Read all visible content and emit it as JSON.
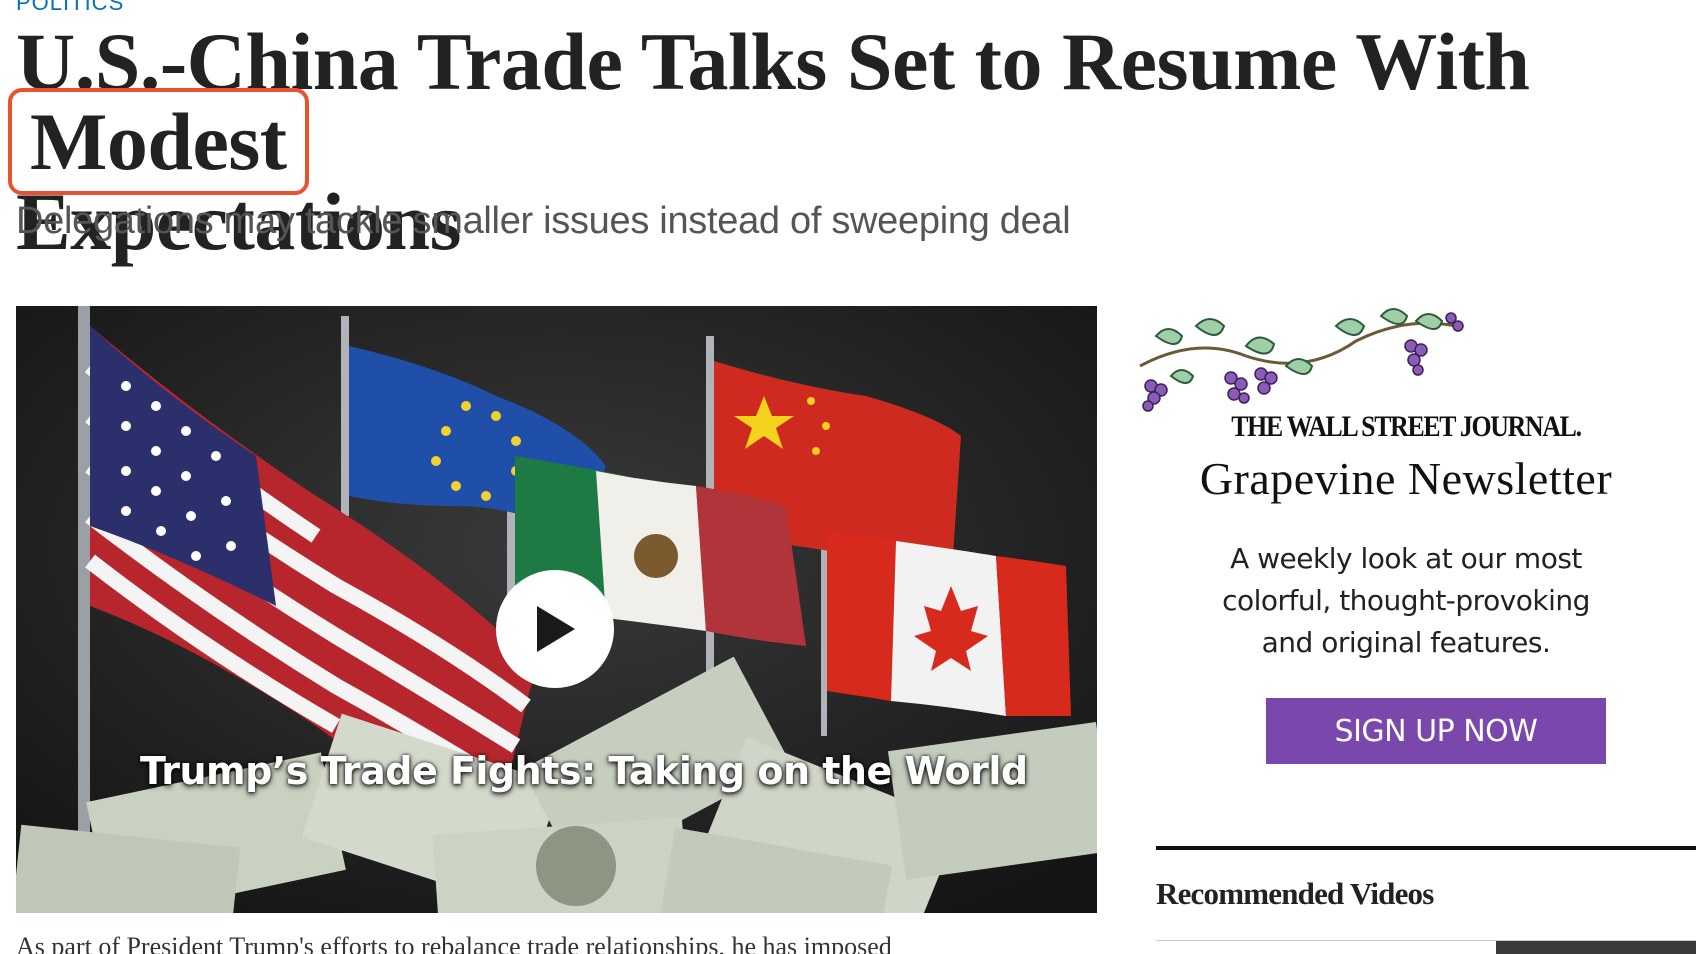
{
  "article": {
    "section": "POLITICS",
    "headline_main": "U.S.-China Trade Talks Set to Resume With",
    "headline_highlight": "Modest",
    "headline_tail": "Expectations",
    "dek": "Delegations may tackle smaller issues instead of sweeping deal",
    "body_first_line": "As part of President Trump's efforts to rebalance trade relationships, he has imposed",
    "highlight_color": "#e8522f"
  },
  "video": {
    "title": "Trump’s Trade Fights: Taking on the World",
    "play_icon": "play-icon"
  },
  "ad": {
    "brand": "THE WALL STREET JOURNAL.",
    "title": "Grapevine Newsletter",
    "copy": "A weekly look at our most colorful, thought-provoking and original features.",
    "button_label": "SIGN UP NOW",
    "button_color": "#7a47ad"
  },
  "sidebar": {
    "recommended_heading": "Recommended Videos"
  }
}
